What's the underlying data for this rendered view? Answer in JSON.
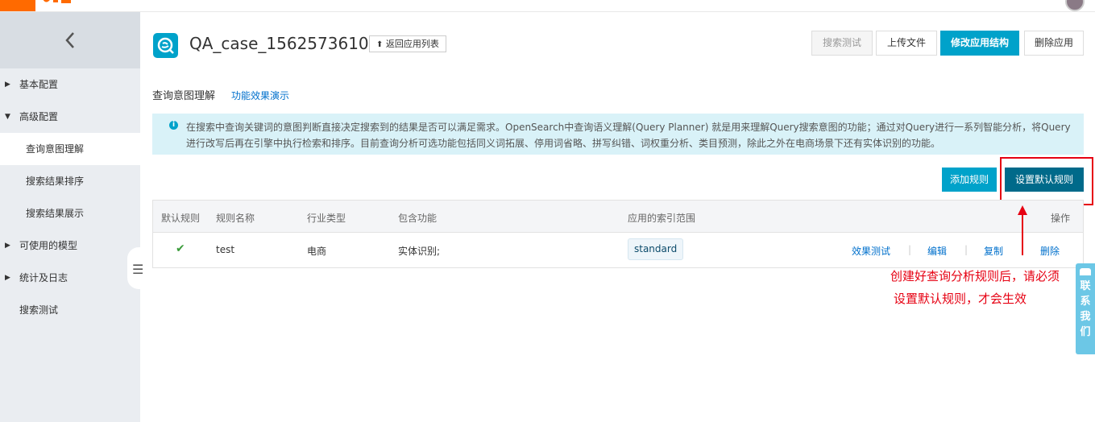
{
  "header": {
    "logo_text": "",
    "colors": {
      "brand": "#ff6a00",
      "accent": "#00a2ca",
      "dark_accent": "#006a8a",
      "annotation": "#e60012"
    }
  },
  "sidebar": {
    "items": [
      {
        "label": "基本配置",
        "expanded": false
      },
      {
        "label": "高级配置",
        "expanded": true
      },
      {
        "label": "查询意图理解",
        "active": true
      },
      {
        "label": "搜索结果排序"
      },
      {
        "label": "搜索结果展示"
      },
      {
        "label": "可使用的模型",
        "expanded": false
      },
      {
        "label": "统计及日志",
        "expanded": false
      },
      {
        "label": "搜索测试"
      }
    ]
  },
  "app": {
    "title": "QA_case_1562573610",
    "back_label": "返回应用列表",
    "buttons": {
      "search_test": "搜索测试",
      "upload": "上传文件",
      "modify": "修改应用结构",
      "delete": "删除应用"
    }
  },
  "section": {
    "title": "查询意图理解",
    "demo_link": "功能效果演示",
    "info": "在搜索中查询关键词的意图判断直接决定搜索到的结果是否可以满足需求。OpenSearch中查询语义理解(Query Planner) 就是用来理解Query搜索意图的功能；通过对Query进行一系列智能分析，将Query进行改写后再在引擎中执行检索和排序。目前查询分析可选功能包括同义词拓展、停用词省略、拼写纠错、词权重分析、类目预测，除此之外在电商场景下还有实体识别的功能。",
    "add_rule": "添加规则",
    "set_default_rule": "设置默认规则"
  },
  "table": {
    "headers": [
      "默认规则",
      "规则名称",
      "行业类型",
      "包含功能",
      "应用的索引范围",
      "操作"
    ],
    "rows": [
      {
        "is_default": true,
        "name": "test",
        "industry": "电商",
        "features": "实体识别;",
        "index_scope": "standard",
        "actions": [
          "效果测试",
          "编辑",
          "复制",
          "删除"
        ]
      }
    ]
  },
  "annotation": {
    "line1": "创建好查询分析规则后，请必须",
    "line2": "设置默认规则，才会生效"
  },
  "contact": {
    "chars": [
      "联",
      "系",
      "我",
      "们"
    ]
  }
}
